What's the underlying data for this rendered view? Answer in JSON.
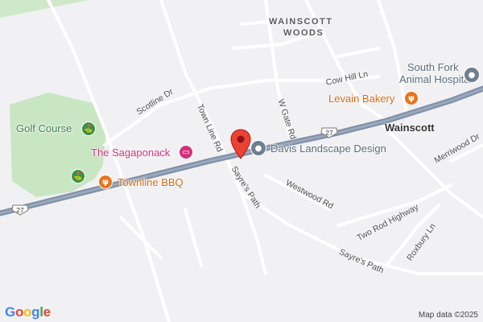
{
  "map": {
    "area_label_line1": "WAINSCOTT",
    "area_label_line2": "WOODS",
    "town_label": "Wainscott",
    "roads": {
      "scotline": "Scotline Dr",
      "town_line": "Town Line Rd",
      "sayres_path_north": "Sayre's Path",
      "w_gate": "W Gate Rd",
      "cow_hill": "Cow Hill Ln",
      "westwood": "Westwood Rd",
      "two_rod": "Two Rod Highway",
      "roxbury": "Roxbury Ln",
      "merriwood": "Merriwood Dr",
      "sayres_path_south": "Sayre's Path"
    },
    "route_shields": {
      "west": "27",
      "center": "27"
    },
    "pois": {
      "golf_course": "Golf Course",
      "sagaponack": "The Sagaponack",
      "townline_bbq": "Townline BBQ",
      "davis_landscape": "Davis Landscape Design",
      "levain_bakery": "Levain Bakery",
      "hospital_line1": "South Fork",
      "hospital_line2": "Animal Hospital"
    },
    "colors": {
      "background": "#f1f1f3",
      "park": "#c9e6c3",
      "highway": "#7f8ea6",
      "marker": "#ea4335",
      "poi_green": "#3a7d44",
      "poi_pink": "#d4307a",
      "poi_orange": "#d86a12",
      "poi_gray": "#5b6a7a"
    }
  },
  "footer": {
    "logo": {
      "letters": [
        "G",
        "o",
        "o",
        "g",
        "l",
        "e"
      ],
      "colors": [
        "#4285f4",
        "#ea4335",
        "#fbbc05",
        "#4285f4",
        "#34a853",
        "#ea4335"
      ]
    },
    "attribution": "Map data ©2025"
  }
}
